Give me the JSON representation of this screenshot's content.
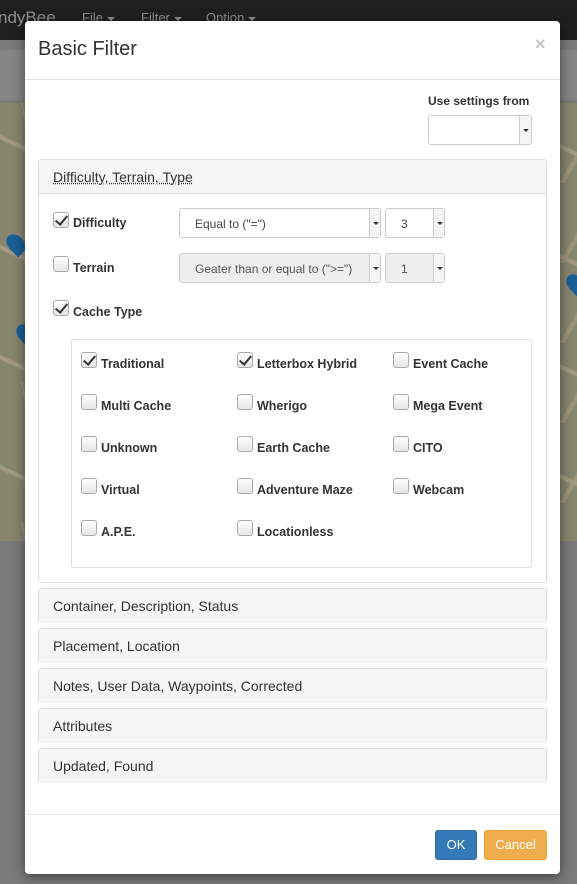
{
  "navbar": {
    "brand": "ndyBee",
    "menus": [
      "File",
      "Filter",
      "Option"
    ]
  },
  "modal": {
    "title": "Basic Filter",
    "close_glyph": "×",
    "use_settings_label": "Use settings from",
    "use_settings_value": ""
  },
  "section_dtt": {
    "heading": "Difficulty, Terrain, Type",
    "difficulty": {
      "label": "Difficulty",
      "checked": true,
      "operator": "Equal to (\"=\")",
      "value": "3"
    },
    "terrain": {
      "label": "Terrain",
      "checked": false,
      "operator": "Geater than or equal to (\">=\")",
      "value": "1"
    },
    "cache_type": {
      "label": "Cache Type",
      "checked": true
    },
    "types": [
      {
        "label": "Traditional",
        "checked": true
      },
      {
        "label": "Letterbox Hybrid",
        "checked": true
      },
      {
        "label": "Event Cache",
        "checked": false
      },
      {
        "label": "Multi Cache",
        "checked": false
      },
      {
        "label": "Wherigo",
        "checked": false
      },
      {
        "label": "Mega Event",
        "checked": false
      },
      {
        "label": "Unknown",
        "checked": false
      },
      {
        "label": "Earth Cache",
        "checked": false
      },
      {
        "label": "CITO",
        "checked": false
      },
      {
        "label": "Virtual",
        "checked": false
      },
      {
        "label": "Adventure Maze",
        "checked": false
      },
      {
        "label": "Webcam",
        "checked": false
      },
      {
        "label": "A.P.E.",
        "checked": false
      },
      {
        "label": "Locationless",
        "checked": false
      }
    ]
  },
  "sections": [
    "Container, Description, Status",
    "Placement, Location",
    "Notes, User Data, Waypoints, Corrected",
    "Attributes",
    "Updated, Found"
  ],
  "footer": {
    "ok": "OK",
    "cancel": "Cancel"
  },
  "colors": {
    "primary": "#337ab7",
    "warning": "#f0ad4e",
    "navbar": "#1f1f1f"
  }
}
